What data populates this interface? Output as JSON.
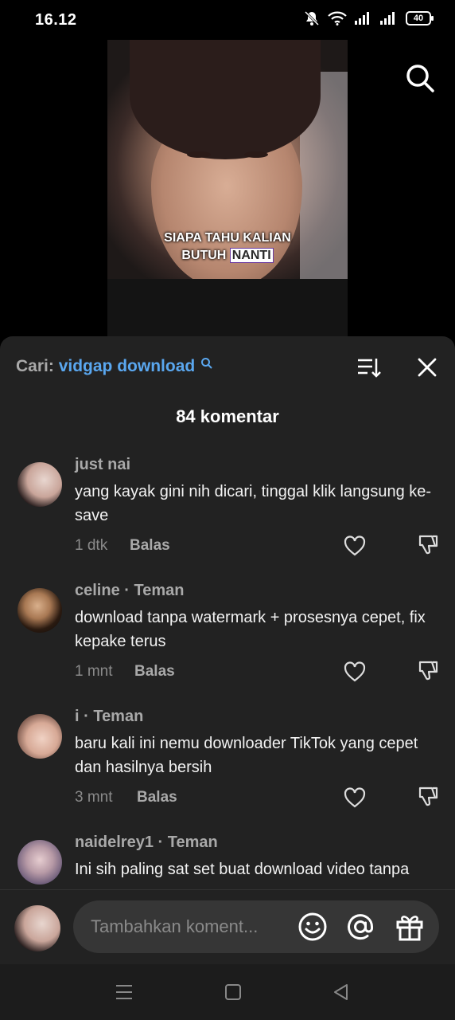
{
  "status_bar": {
    "time": "16.12",
    "battery": "40"
  },
  "video": {
    "caption_line1": "SIAPA TAHU KALIAN",
    "caption_line2_a": "BUTUH ",
    "caption_line2_b": "NANTI"
  },
  "comments_panel": {
    "search_prefix": "Cari:",
    "search_query": "vidgap download",
    "title": "84 komentar",
    "comments": [
      {
        "user": "just nai",
        "text": "yang kayak gini nih dicari, tinggal klik langsung ke-save",
        "time": "1 dtk",
        "reply": "Balas"
      },
      {
        "user": "celine · Teman",
        "text": "download tanpa watermark + prosesnya cepet, fix kepake terus",
        "time": "1 mnt",
        "reply": "Balas"
      },
      {
        "user": "i · Teman",
        "text": "baru kali ini nemu downloader TikTok yang cepet dan hasilnya bersih",
        "time": "3 mnt",
        "reply": "Balas"
      },
      {
        "user": "naidelrey1 · Teman",
        "text": "Ini sih paling sat set buat download video tanpa",
        "time": "",
        "reply": ""
      }
    ],
    "input_placeholder": "Tambahkan koment..."
  },
  "colors": {
    "sheet_bg": "#222222",
    "accent_link": "#5aa7ef",
    "muted_text": "#a9a9a9",
    "input_bg": "#363636"
  },
  "icons": [
    "search-icon",
    "sort-icon",
    "close-icon",
    "heart-icon",
    "dislike-icon",
    "emoji-icon",
    "mention-icon",
    "gift-icon",
    "menu-nav-icon",
    "home-nav-icon",
    "back-nav-icon"
  ]
}
